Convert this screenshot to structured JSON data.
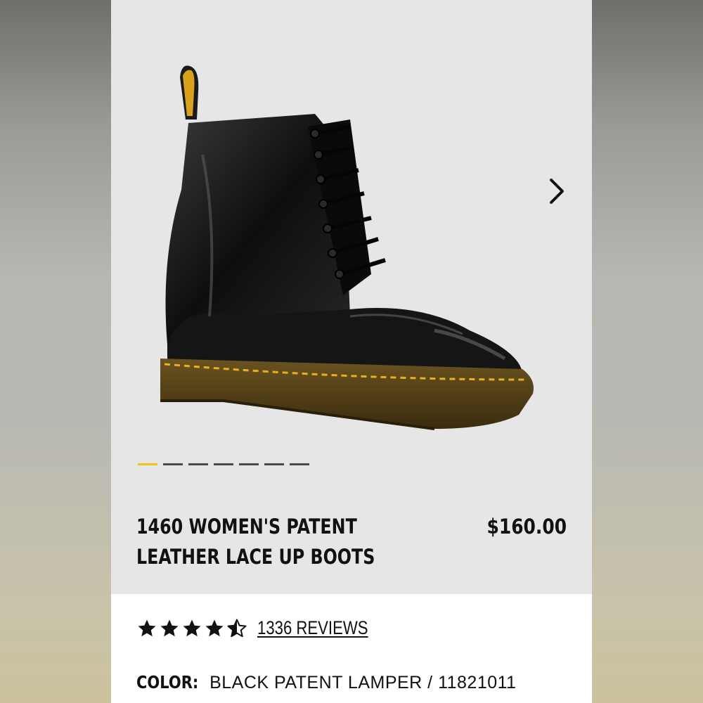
{
  "gallery": {
    "next_icon": "chevron-right-icon",
    "image_count": 7,
    "active_index": 0,
    "active_color": "#f2c21b",
    "inactive_color": "#4a4a4a"
  },
  "product": {
    "title_line1": "1460 WOMEN'S PATENT",
    "title_line2": "LEATHER LACE UP BOOTS",
    "price": "$160.00",
    "rating": 4.5,
    "reviews_label": "1336 REVIEWS",
    "color_label": "COLOR:",
    "color_value": "BLACK PATENT LAMPER / 11821011"
  }
}
